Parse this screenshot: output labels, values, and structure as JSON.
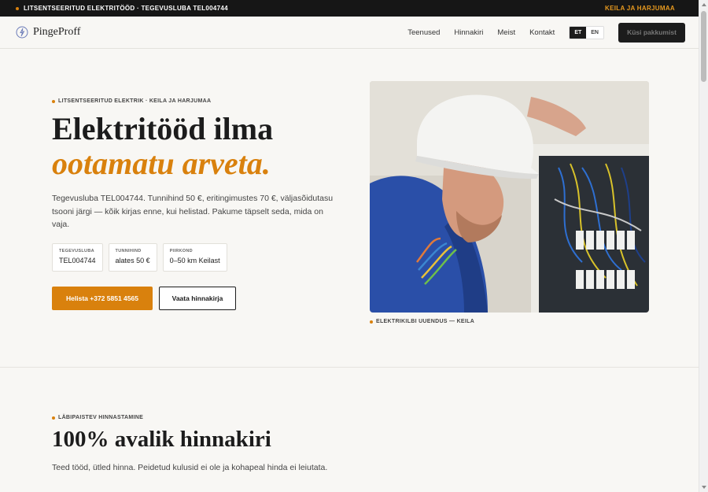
{
  "topbar": {
    "left_text": "LITSENTSEERITUD ELEKTRITÖÖD · TEGEVUSLUBA TEL004744",
    "right_text": "KEILA JA HARJUMAA"
  },
  "nav": {
    "logo_text": "PingeProff",
    "menu": [
      "Teenused",
      "Hinnakiri",
      "Meist",
      "Kontakt"
    ],
    "lang_active": "ET",
    "lang_inactive": "EN",
    "cta_label": "Küsi pakkumist"
  },
  "hero": {
    "eyebrow": "LITSENTSEERITUD ELEKTRIK · KEILA JA HARJUMAA",
    "title_line1": "Elektritööd ilma",
    "title_line2": "ootamatu arveta.",
    "paragraph": "Tegevusluba TEL004744. Tunnihind 50 €, eritingimustes 70 €, väljasõidutasu tsooni järgi — kõik kirjas enne, kui helistad. Pakume täpselt seda, mida on vaja.",
    "stats": [
      {
        "label": "TEGEVUSLUBA",
        "value": "TEL004744"
      },
      {
        "label": "TUNNIHIND",
        "value": "alates 50 €"
      },
      {
        "label": "PIIRKOND",
        "value": "0–50 km Keilast"
      }
    ],
    "primary_button": "Helista +372 5851 4565",
    "secondary_button": "Vaata hinnakirja",
    "photo_caption": "ELEKTRIKILBI UUENDUS — KEILA"
  },
  "pricing": {
    "eyebrow": "LÄBIPAISTEV HINNASTAMINE",
    "title": "100% avalik hinnakiri",
    "paragraph": "Teed tööd, ütled hinna. Peidetud kulusid ei ole ja kohapeal hinda ei leiutata."
  },
  "colors": {
    "accent": "#d9810d",
    "dark": "#161616",
    "background": "#f8f7f4"
  }
}
